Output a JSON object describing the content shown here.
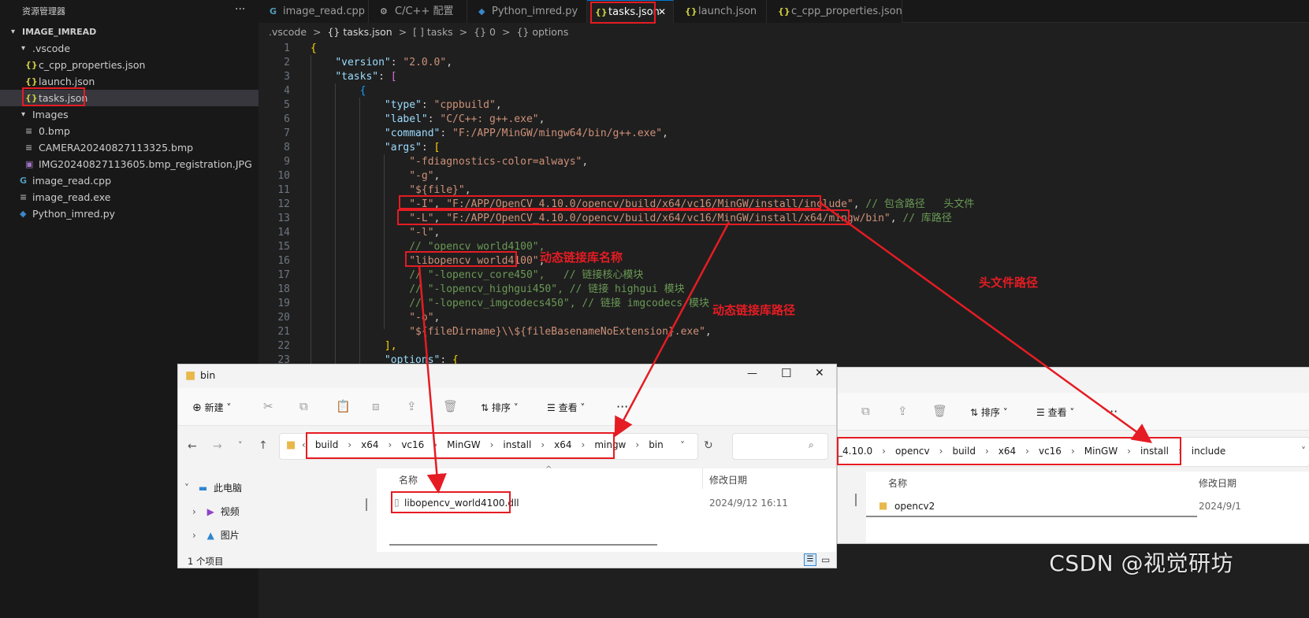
{
  "sidebar": {
    "title": "资源管理器",
    "more": "···",
    "root": "IMAGE_IMREAD",
    "items": [
      {
        "label": ".vscode",
        "icon": "folder",
        "kind": "folder"
      },
      {
        "label": "c_cpp_properties.json",
        "icon": "{}",
        "kind": "json"
      },
      {
        "label": "launch.json",
        "icon": "{}",
        "kind": "json"
      },
      {
        "label": "tasks.json",
        "icon": "{}",
        "kind": "json"
      },
      {
        "label": "Images",
        "icon": "folder",
        "kind": "folder"
      },
      {
        "label": "0.bmp",
        "icon": "image",
        "kind": "file"
      },
      {
        "label": "CAMERA20240827113325.bmp",
        "icon": "image",
        "kind": "file"
      },
      {
        "label": "IMG20240827113605.bmp_registration.JPG",
        "icon": "image",
        "kind": "img"
      },
      {
        "label": "image_read.cpp",
        "icon": "C++",
        "kind": "cpp"
      },
      {
        "label": "image_read.exe",
        "icon": "file",
        "kind": "file"
      },
      {
        "label": "Python_imred.py",
        "icon": "python",
        "kind": "py"
      }
    ]
  },
  "tabs": [
    {
      "label": "image_read.cpp",
      "icon": "G"
    },
    {
      "label": "C/C++ 配置",
      "icon": "⚙"
    },
    {
      "label": "Python_imred.py",
      "icon": "◆"
    },
    {
      "label": "tasks.json",
      "icon": "{}"
    },
    {
      "label": "launch.json",
      "icon": "{}"
    },
    {
      "label": "c_cpp_properties.json",
      "icon": "{}"
    }
  ],
  "tab_close": "✕",
  "breadcrumb": [
    ".vscode",
    ">",
    "{} tasks.json",
    ">",
    "[ ] tasks",
    ">",
    "{} 0",
    ">",
    "{} options"
  ],
  "code_lines": [
    [
      [
        "p",
        "{"
      ]
    ],
    [
      [
        "w",
        "    "
      ],
      [
        "k",
        "\"version\""
      ],
      [
        "w",
        ": "
      ],
      [
        "s",
        "\"2.0.0\""
      ],
      [
        "w",
        ","
      ]
    ],
    [
      [
        "w",
        "    "
      ],
      [
        "k",
        "\"tasks\""
      ],
      [
        "w",
        ": "
      ],
      [
        "b",
        "["
      ]
    ],
    [
      [
        "w",
        "        "
      ],
      [
        "br",
        "{"
      ]
    ],
    [
      [
        "w",
        "            "
      ],
      [
        "k",
        "\"type\""
      ],
      [
        "w",
        ": "
      ],
      [
        "s",
        "\"cppbuild\""
      ],
      [
        "w",
        ","
      ]
    ],
    [
      [
        "w",
        "            "
      ],
      [
        "k",
        "\"label\""
      ],
      [
        "w",
        ": "
      ],
      [
        "s",
        "\"C/C++: g++.exe\""
      ],
      [
        "w",
        ","
      ]
    ],
    [
      [
        "w",
        "            "
      ],
      [
        "k",
        "\"command\""
      ],
      [
        "w",
        ": "
      ],
      [
        "s",
        "\"F:/APP/MinGW/mingw64/bin/g++.exe\""
      ],
      [
        "w",
        ","
      ]
    ],
    [
      [
        "w",
        "            "
      ],
      [
        "k",
        "\"args\""
      ],
      [
        "w",
        ": "
      ],
      [
        "p",
        "["
      ]
    ],
    [
      [
        "w",
        "                "
      ],
      [
        "s",
        "\"-fdiagnostics-color=always\""
      ],
      [
        "w",
        ","
      ]
    ],
    [
      [
        "w",
        "                "
      ],
      [
        "s",
        "\"-g\""
      ],
      [
        "w",
        ","
      ]
    ],
    [
      [
        "w",
        "                "
      ],
      [
        "s",
        "\"${file}\""
      ],
      [
        "w",
        ","
      ]
    ],
    [
      [
        "w",
        "                "
      ],
      [
        "s",
        "\"-I\""
      ],
      [
        "w",
        ", "
      ],
      [
        "s",
        "\"F:/APP/OpenCV_4.10.0/opencv/build/x64/vc16/MinGW/install/include\""
      ],
      [
        "w",
        ", "
      ],
      [
        "c",
        "// 包含路径   头文件"
      ]
    ],
    [
      [
        "w",
        "                "
      ],
      [
        "s",
        "\"-L\""
      ],
      [
        "w",
        ", "
      ],
      [
        "s",
        "\"F:/APP/OpenCV_4.10.0/opencv/build/x64/vc16/MinGW/install/x64/mingw/bin\""
      ],
      [
        "w",
        ", "
      ],
      [
        "c",
        "// 库路径"
      ]
    ],
    [
      [
        "w",
        "                "
      ],
      [
        "s",
        "\"-l\""
      ],
      [
        "w",
        ","
      ]
    ],
    [
      [
        "w",
        "                "
      ],
      [
        "c",
        "// \"opencv_world4100\","
      ]
    ],
    [
      [
        "w",
        "                "
      ],
      [
        "s",
        "\"libopencv_world4100\""
      ],
      [
        "w",
        ","
      ]
    ],
    [
      [
        "w",
        "                "
      ],
      [
        "c",
        "// \"-lopencv_core450\",   // 链接核心模块"
      ]
    ],
    [
      [
        "w",
        "                "
      ],
      [
        "c",
        "// \"-lopencv_highgui450\", // 链接 highgui 模块"
      ]
    ],
    [
      [
        "w",
        "                "
      ],
      [
        "c",
        "// \"-lopencv_imgcodecs450\", // 链接 imgcodecs 模块"
      ]
    ],
    [
      [
        "w",
        "                "
      ],
      [
        "s",
        "\"-o\""
      ],
      [
        "w",
        ","
      ]
    ],
    [
      [
        "w",
        "                "
      ],
      [
        "s",
        "\"${fileDirname}\\\\${fileBasenameNoExtension}.exe\""
      ],
      [
        "w",
        ","
      ]
    ],
    [
      [
        "w",
        "            "
      ],
      [
        "p",
        "],"
      ]
    ],
    [
      [
        "w",
        "            "
      ],
      [
        "k",
        "\"options\""
      ],
      [
        "w",
        ": "
      ],
      [
        "p",
        "{"
      ]
    ]
  ],
  "annotations": {
    "dll_name": "动态链接库名称",
    "header_path": "头文件路径",
    "dll_path": "动态链接库路径"
  },
  "explorer_bin": {
    "title": "bin",
    "min": "—",
    "max": "☐",
    "close": "✕",
    "new_label": "新建",
    "sort_label": "排序",
    "view_label": "查看",
    "more": "···",
    "path": [
      "‹",
      "build",
      "›",
      "x64",
      "›",
      "vc16",
      "›",
      "MinGW",
      "›",
      "install",
      "›",
      "x64",
      "›",
      "mingw",
      "›",
      "bin"
    ],
    "nav": [
      {
        "label": "此电脑"
      },
      {
        "label": "视频"
      },
      {
        "label": "图片"
      }
    ],
    "col_name": "名称",
    "col_date": "修改日期",
    "file_name": "libopencv_world4100.dll",
    "file_date": "2024/9/12 16:11",
    "status": "1 个项目"
  },
  "explorer_include": {
    "sort_label": "排序",
    "view_label": "查看",
    "more": "···",
    "path": [
      "_4.10.0",
      "›",
      "opencv",
      "›",
      "build",
      "›",
      "x64",
      "›",
      "vc16",
      "›",
      "MinGW",
      "›",
      "install",
      "›",
      "include"
    ],
    "col_name": "名称",
    "col_date": "修改日期",
    "folder_name": "opencv2",
    "folder_date": "2024/9/1"
  },
  "watermark": "CSDN @视觉研坊",
  "colors": {
    "highlight": "#e51c23",
    "accent": "#0078d4"
  }
}
